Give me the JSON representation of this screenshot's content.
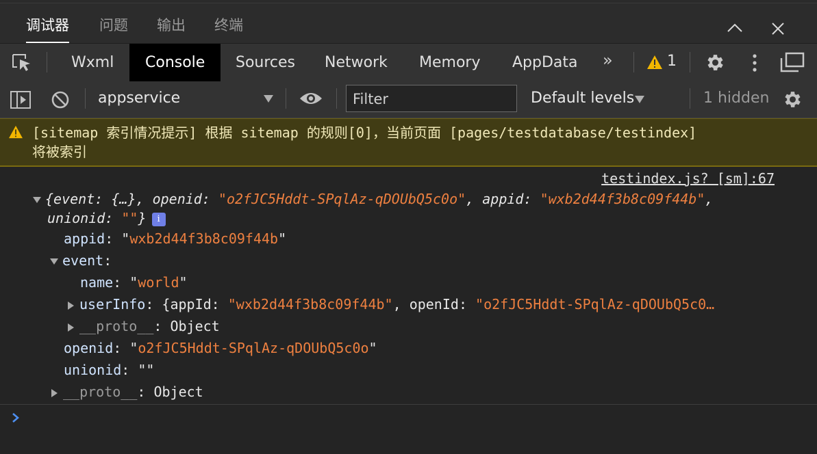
{
  "panel_tabs": [
    "调试器",
    "问题",
    "输出",
    "终端"
  ],
  "devtools_tabs": [
    "Wxml",
    "Console",
    "Sources",
    "Network",
    "Memory",
    "AppData"
  ],
  "active_devtools_tab": "Console",
  "warning_badge_count": "1",
  "filterbar": {
    "context": "appservice",
    "filter_placeholder": "Filter",
    "levels": "Default levels",
    "hidden": "1 hidden"
  },
  "warning_message": {
    "line1": "[sitemap 索引情况提示] 根据 sitemap 的规则[0]，当前页面 [pages/testdatabase/testindex]",
    "line2": "将被索引"
  },
  "log": {
    "source": "testindex.js? [sm]:67",
    "summary": {
      "k_event": "event",
      "v_event": "{…}",
      "k_openid": "openid",
      "v_openid": "\"o2fJC5Hddt-SPqlAz-qDOUbQ5c0o\"",
      "k_appid": "appid",
      "v_appid": "\"wxb2d44f3b8c09f44b\"",
      "k_unionid": "unionid",
      "v_unionid": "\"\""
    },
    "props": {
      "appid_key": "appid",
      "appid_val": "wxb2d44f3b8c09f44b",
      "event_key": "event",
      "name_key": "name",
      "name_val": "world",
      "userinfo_key": "userInfo",
      "userinfo_appid_key": "appId",
      "userinfo_appid_val": "\"wxb2d44f3b8c09f44b\"",
      "userinfo_openid_key": "openId",
      "userinfo_openid_val": "\"o2fJC5Hddt-SPqlAz-qDOUbQ5c0…",
      "proto_key": "__proto__",
      "proto_val": "Object",
      "openid_key": "openid",
      "openid_val": "o2fJC5Hddt-SPqlAz-qDOUbQ5c0o",
      "unionid_key": "unionid",
      "unionid_val": "\"\""
    }
  },
  "colors": {
    "string": "#ee8040",
    "warning_bg": "#413c14",
    "warning_icon": "#f2b600",
    "prompt": "#4d8ff0",
    "info_badge": "#6f7fe6"
  }
}
